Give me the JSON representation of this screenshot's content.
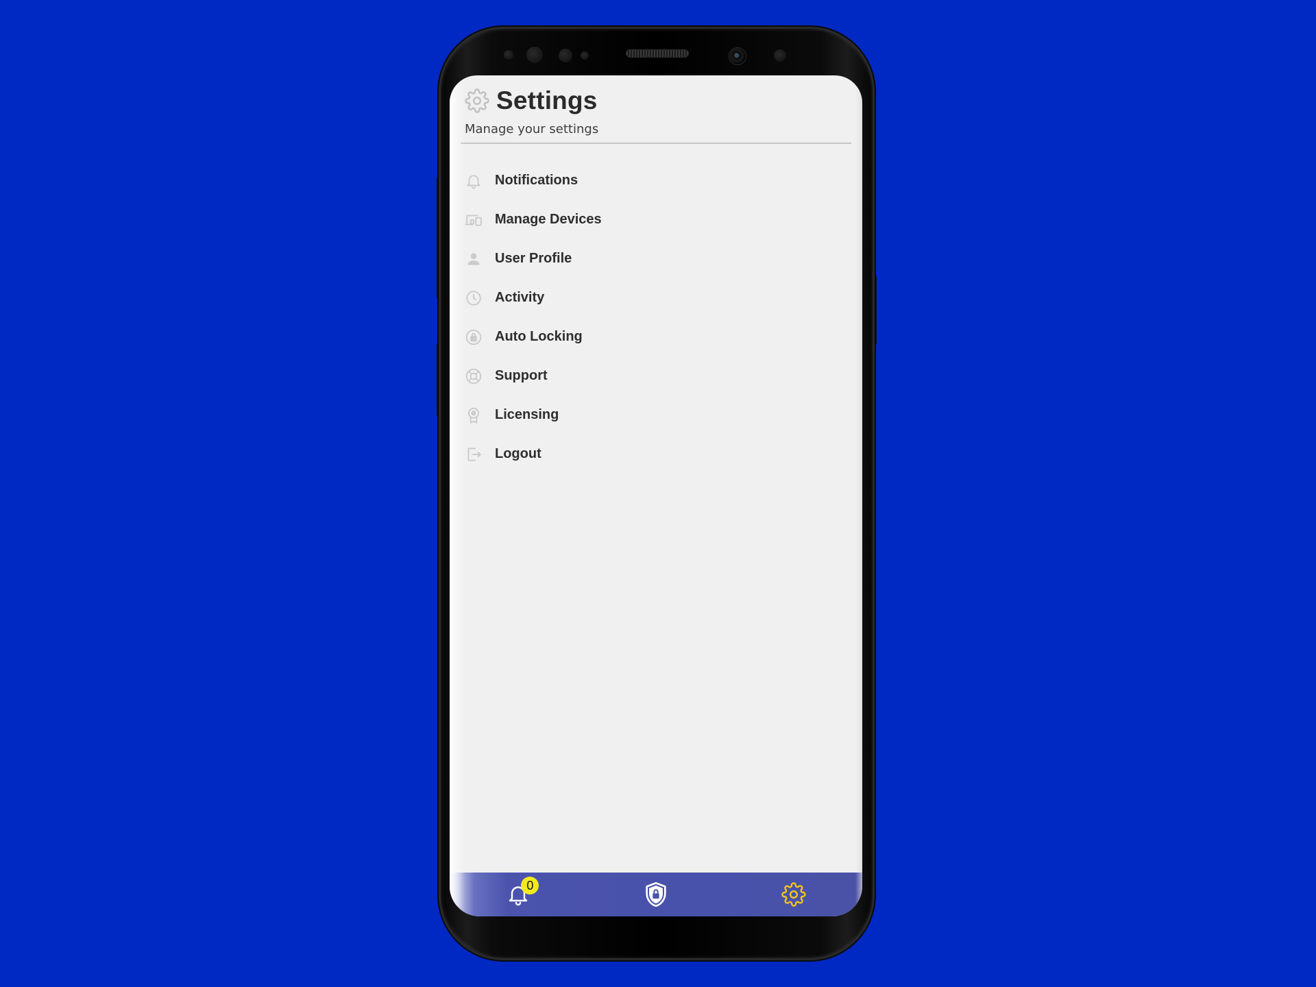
{
  "colors": {
    "background": "#0029c3",
    "screen": "#f0f0f0",
    "nav_bar": "#4852aa",
    "active_nav": "#f5c518",
    "badge": "#f2ea1d",
    "icon_muted": "#c8c8c8",
    "text": "#2e2e2e"
  },
  "header": {
    "icon": "gear-icon",
    "title": "Settings",
    "subtitle": "Manage your settings"
  },
  "menu": {
    "items": [
      {
        "label": "Notifications",
        "icon": "bell-icon"
      },
      {
        "label": "Manage Devices",
        "icon": "devices-icon"
      },
      {
        "label": "User Profile",
        "icon": "user-icon"
      },
      {
        "label": "Activity",
        "icon": "clock-icon"
      },
      {
        "label": "Auto Locking",
        "icon": "lock-circle-icon"
      },
      {
        "label": "Support",
        "icon": "lifebuoy-icon"
      },
      {
        "label": "Licensing",
        "icon": "certificate-icon"
      },
      {
        "label": "Logout",
        "icon": "logout-icon"
      }
    ]
  },
  "bottom_nav": {
    "items": [
      {
        "icon": "bell-icon",
        "badge": "0"
      },
      {
        "icon": "shield-lock-icon"
      },
      {
        "icon": "gear-icon",
        "active": true
      }
    ]
  }
}
